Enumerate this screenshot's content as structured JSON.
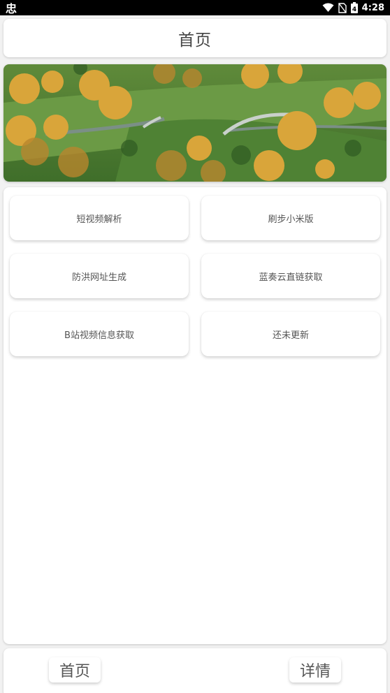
{
  "status_bar": {
    "left_icon": "app-notification-icon",
    "left_glyph": "忠",
    "time": "4:28",
    "battery_level": "4"
  },
  "header": {
    "title": "首页"
  },
  "banner": {
    "image": "aerial-landscape-bridge"
  },
  "tools": [
    {
      "label": "短视频解析"
    },
    {
      "label": "刷步小米版"
    },
    {
      "label": "防洪网址生成"
    },
    {
      "label": "蓝奏云直链获取"
    },
    {
      "label": "B站视频信息获取"
    },
    {
      "label": "还未更新"
    }
  ],
  "bottom_nav": {
    "home_label": "首页",
    "detail_label": "详情"
  },
  "colors": {
    "background": "#f2f2f2",
    "card": "#ffffff",
    "text": "#555555"
  }
}
